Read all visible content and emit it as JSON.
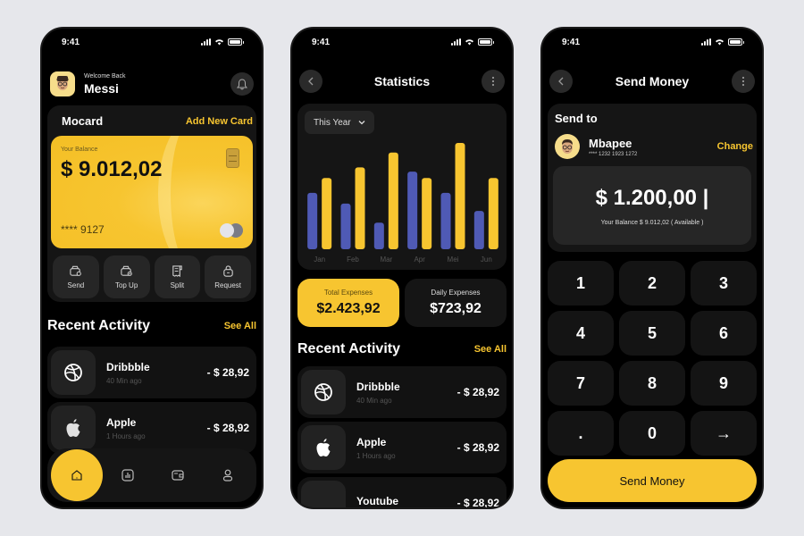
{
  "colors": {
    "accent": "#f7c530",
    "blue": "#4f5ab5",
    "background": "#e6e7eb",
    "phone": "#000000",
    "panel": "#151515"
  },
  "status_bar": {
    "time": "9:41"
  },
  "home": {
    "welcome": "Welcome Back",
    "user_name": "Messi",
    "card_section_title": "Mocard",
    "add_card_label": "Add New Card",
    "card": {
      "balance_label": "Your Balance",
      "balance": "$ 9.012,02",
      "number": "**** 9127"
    },
    "actions": [
      {
        "label": "Send",
        "icon": "wallet-send-icon"
      },
      {
        "label": "Top Up",
        "icon": "wallet-topup-icon"
      },
      {
        "label": "Split",
        "icon": "receipt-icon"
      },
      {
        "label": "Request",
        "icon": "bag-icon"
      }
    ],
    "recent_title": "Recent Activity",
    "see_all": "See All",
    "activities": [
      {
        "name": "Dribbble",
        "time": "40 Min ago",
        "amount": "- $ 28,92",
        "icon": "dribbble-icon"
      },
      {
        "name": "Apple",
        "time": "1 Hours ago",
        "amount": "- $ 28,92",
        "icon": "apple-icon"
      }
    ],
    "nav": [
      {
        "name": "home",
        "icon": "home-icon",
        "active": true
      },
      {
        "name": "statistics",
        "icon": "chart-icon",
        "active": false
      },
      {
        "name": "wallet",
        "icon": "wallet-icon",
        "active": false
      },
      {
        "name": "profile",
        "icon": "user-icon",
        "active": false
      }
    ]
  },
  "stats": {
    "title": "Statistics",
    "period": "This Year",
    "total_label": "Total Expenses",
    "total_value": "$2.423,92",
    "daily_label": "Daily Expenses",
    "daily_value": "$723,92",
    "recent_title": "Recent Activity",
    "see_all": "See All",
    "activities": [
      {
        "name": "Dribbble",
        "time": "40 Min ago",
        "amount": "- $ 28,92",
        "icon": "dribbble-icon"
      },
      {
        "name": "Apple",
        "time": "1 Hours ago",
        "amount": "- $ 28,92",
        "icon": "apple-icon"
      },
      {
        "name": "Youtube",
        "time": "",
        "amount": "- $ 28,92",
        "icon": "youtube-icon"
      }
    ]
  },
  "chart_data": {
    "type": "bar",
    "title": "",
    "xlabel": "",
    "ylabel": "",
    "categories": [
      "Jan",
      "Feb",
      "Mar",
      "Apr",
      "Mei",
      "Jun"
    ],
    "series": [
      {
        "name": "Series 1",
        "color": "#4f5ab5",
        "values": [
          53,
          43,
          25,
          73,
          53,
          36
        ]
      },
      {
        "name": "Series 2",
        "color": "#f7c530",
        "values": [
          67,
          77,
          91,
          67,
          100,
          67
        ]
      }
    ],
    "ylim": [
      0,
      100
    ],
    "grid": false,
    "legend": "none"
  },
  "send": {
    "title": "Send Money",
    "send_to_label": "Send to",
    "recipient_name": "Mbapee",
    "recipient_account": "**** 1232 1923 1272",
    "change_label": "Change",
    "amount": "$ 1.200,00 |",
    "available": "Your Balance $ 9.012,02 ( Available )",
    "keys": [
      "1",
      "2",
      "3",
      "4",
      "5",
      "6",
      "7",
      "8",
      "9",
      ".",
      "0",
      "→"
    ],
    "send_button": "Send Money"
  }
}
